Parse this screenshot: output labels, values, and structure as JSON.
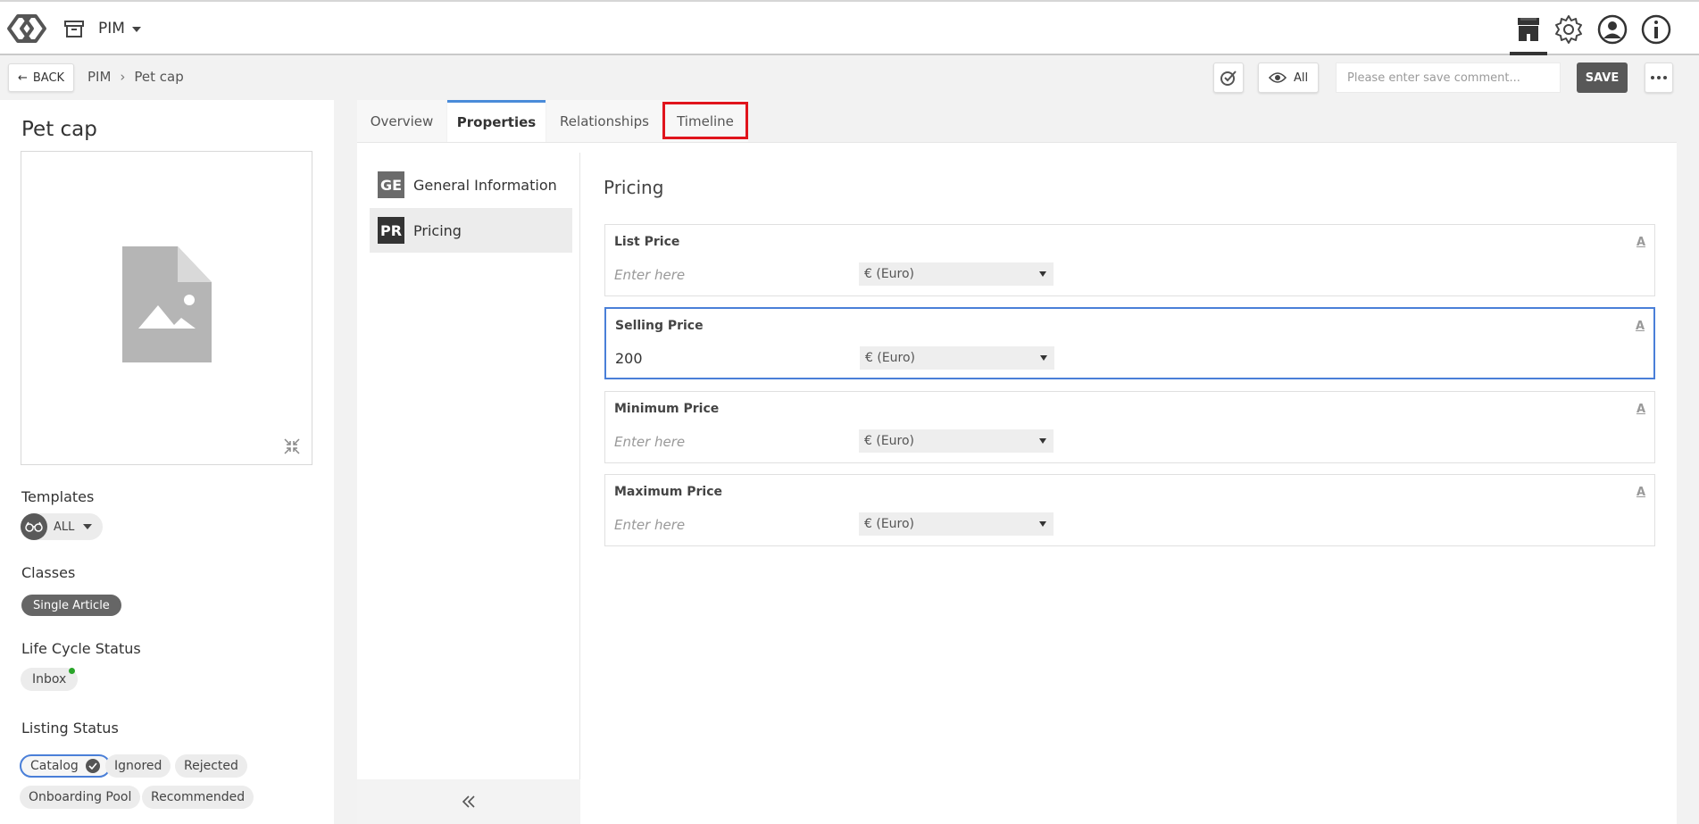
{
  "header": {
    "app_name": "PIM",
    "icons": [
      "logo-icon",
      "archive-icon",
      "store-icon",
      "gear-icon",
      "user-icon",
      "info-icon"
    ]
  },
  "subheader": {
    "back_label": "BACK",
    "breadcrumb": [
      "PIM",
      "Pet cap"
    ],
    "breadcrumb_sep": "›",
    "view_filter_label": "All",
    "comment_placeholder": "Please enter save comment...",
    "save_label": "SAVE"
  },
  "left_panel": {
    "title": "Pet cap",
    "templates_label": "Templates",
    "template_value": "ALL",
    "classes_label": "Classes",
    "class_value": "Single Article",
    "lifecycle_label": "Life Cycle Status",
    "lifecycle_value": "Inbox",
    "listing_label": "Listing Status",
    "listing_chips": [
      "Catalog",
      "Ignored",
      "Rejected",
      "Onboarding Pool",
      "Recommended"
    ]
  },
  "tabs": [
    "Overview",
    "Properties",
    "Relationships",
    "Timeline"
  ],
  "active_tab": "Properties",
  "nav": [
    {
      "abbr": "GE",
      "label": "General Information"
    },
    {
      "abbr": "PR",
      "label": "Pricing"
    }
  ],
  "section": {
    "title": "Pricing",
    "fields": [
      {
        "label": "List Price",
        "value": "",
        "placeholder": "Enter here",
        "currency": "€ (Euro)",
        "lang": "A"
      },
      {
        "label": "Selling Price",
        "value": "200",
        "placeholder": "Enter here",
        "currency": "€ (Euro)",
        "lang": "A"
      },
      {
        "label": "Minimum Price",
        "value": "",
        "placeholder": "Enter here",
        "currency": "€ (Euro)",
        "lang": "A"
      },
      {
        "label": "Maximum Price",
        "value": "",
        "placeholder": "Enter here",
        "currency": "€ (Euro)",
        "lang": "A"
      }
    ]
  },
  "colors": {
    "accent_blue": "#4a8cda",
    "highlight_red": "#e0141c",
    "status_green": "#2aa52a"
  }
}
